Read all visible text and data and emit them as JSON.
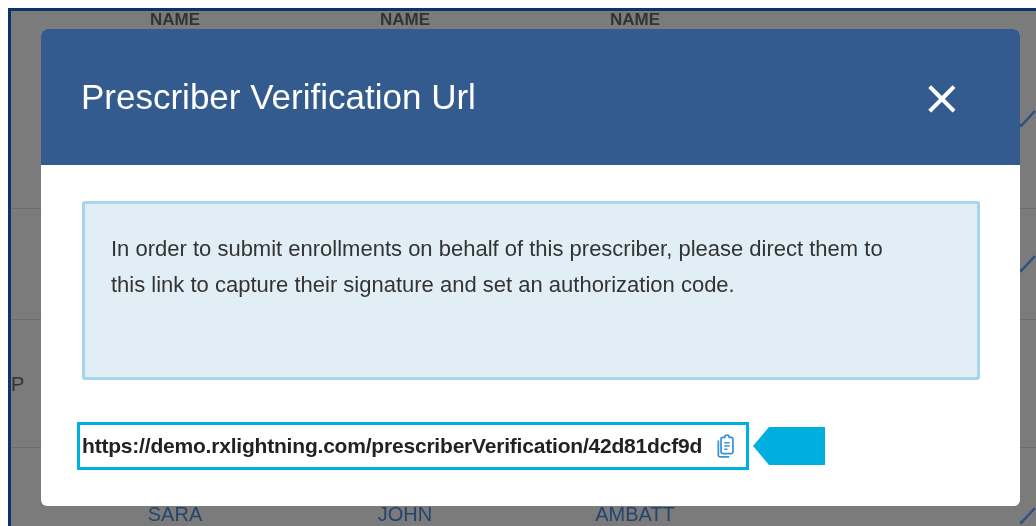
{
  "background_table": {
    "columns": [
      "",
      "NAME",
      "NAME",
      "NAME"
    ],
    "rows": [
      {
        "cells": [],
        "checked": true
      },
      {
        "cells": [],
        "checked": true
      },
      {
        "cells": [
          "P"
        ],
        "checked": false
      },
      {
        "cells": [
          "",
          "SARA",
          "JOHN",
          "AMBATT"
        ],
        "checked": true
      }
    ]
  },
  "dialog": {
    "title": "Prescriber Verification Url",
    "close": "×",
    "message": "In order to submit enrollments on behalf of this prescriber, please direct them to this link to capture their signature and set an authorization code.",
    "url": "https://demo.rxlightning.com/prescriberVerification/42d81dcf9d",
    "callout": true
  }
}
